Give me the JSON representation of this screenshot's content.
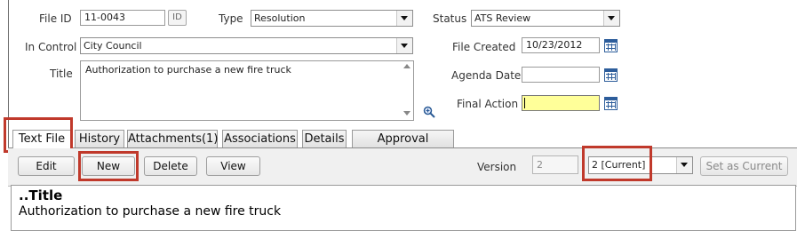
{
  "form": {
    "file_id_label": "File ID",
    "file_id_value": "11-0043",
    "id_button": "ID",
    "type_label": "Type",
    "type_value": "Resolution",
    "status_label": "Status",
    "status_value": "ATS Review",
    "in_control_label": "In Control",
    "in_control_value": "City Council",
    "file_created_label": "File Created",
    "file_created_value": "10/23/2012",
    "title_label": "Title",
    "title_value": "Authorization to purchase a new fire truck",
    "agenda_date_label": "Agenda Date",
    "agenda_date_value": "",
    "final_action_label": "Final Action",
    "final_action_value": ""
  },
  "tabs": [
    {
      "label": "Text File"
    },
    {
      "label": "History"
    },
    {
      "label": "Attachments(1)"
    },
    {
      "label": "Associations"
    },
    {
      "label": "Details"
    },
    {
      "label": "Approval Tracking"
    }
  ],
  "toolbar": {
    "edit": "Edit",
    "new": "New",
    "delete": "Delete",
    "view": "View",
    "version_label": "Version",
    "version_value": "2",
    "version_select": "2 [Current]",
    "set_current": "Set as Current"
  },
  "content": {
    "heading": "..Title",
    "body": "Authorization to purchase a new fire truck"
  },
  "colors": {
    "highlight": "#c0392b",
    "final_action_bg": "#ffff99",
    "calendar_icon": "#2d5d9b"
  },
  "icons": [
    "calendar-icon",
    "zoom-in-icon",
    "dropdown-arrow-icon"
  ]
}
